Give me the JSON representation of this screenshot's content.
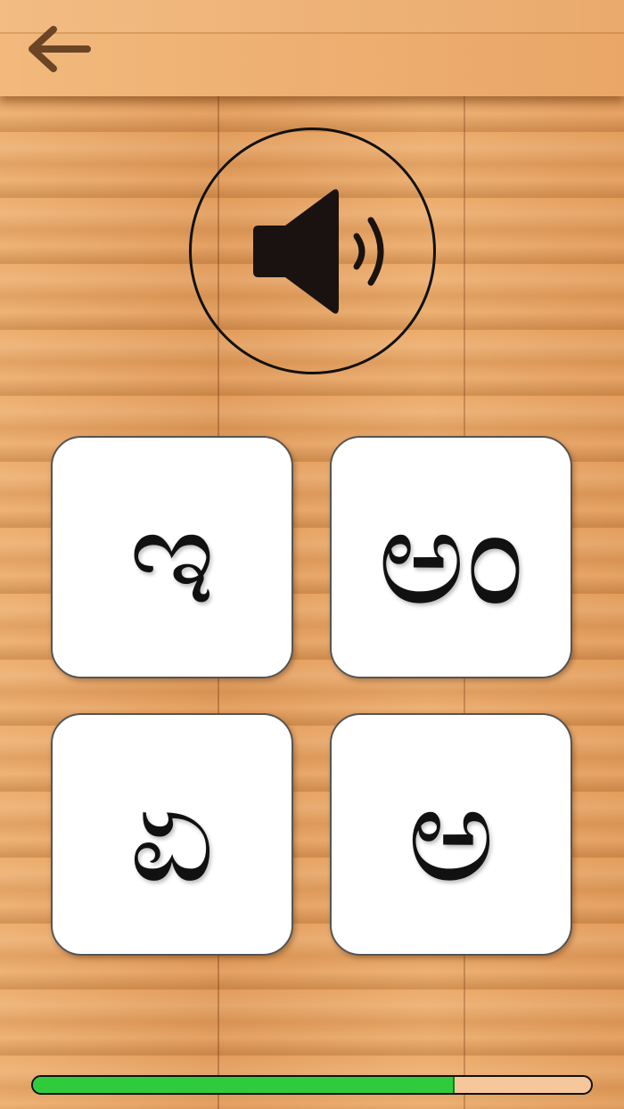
{
  "header": {
    "back_icon": "arrow-left-icon",
    "icon_color": "#6b4526"
  },
  "prompt": {
    "speaker_icon": "speaker-volume-icon"
  },
  "answers": [
    {
      "letter": "ಇ"
    },
    {
      "letter": "ಅಂ"
    },
    {
      "letter": "ಏ"
    },
    {
      "letter": "ಅ"
    }
  ],
  "progress": {
    "value": 0.755,
    "fill_color": "#2fcb3c"
  }
}
